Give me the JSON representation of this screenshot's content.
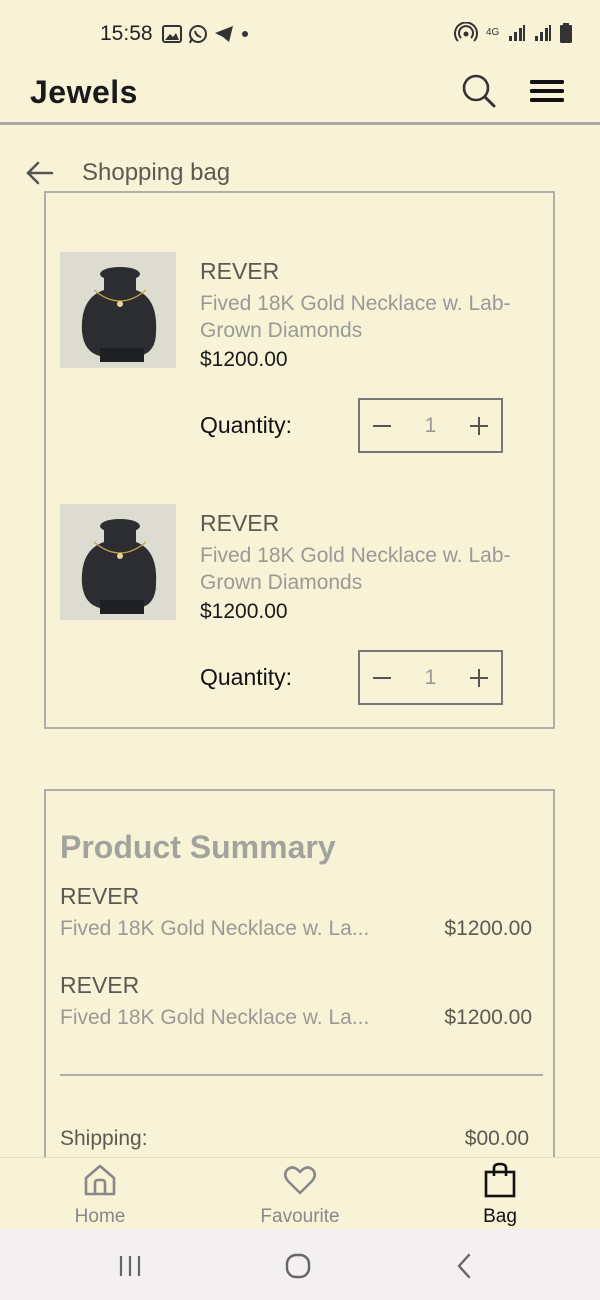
{
  "status_bar": {
    "time": "15:58",
    "left_icons": [
      "gallery-icon",
      "whatsapp-icon",
      "telegram-icon",
      "dot-icon"
    ],
    "right_icons": [
      "hotspot-icon",
      "network-4g-icon",
      "signal-icon",
      "signal-icon",
      "battery-icon"
    ],
    "network_label": "4G"
  },
  "app_bar": {
    "title": "Jewels",
    "icons": [
      "search-icon",
      "menu-icon"
    ]
  },
  "page": {
    "title": "Shopping bag",
    "back_icon": "arrow-left-icon"
  },
  "bag": {
    "items": [
      {
        "brand": "REVER",
        "name": "Fived 18K Gold Necklace w. Lab-Grown Diamonds",
        "price": "$1200.00",
        "quantity_label": "Quantity:",
        "quantity": "1"
      },
      {
        "brand": "REVER",
        "name": "Fived 18K Gold Necklace w. Lab-Grown Diamonds",
        "price": "$1200.00",
        "quantity_label": "Quantity:",
        "quantity": "1"
      }
    ]
  },
  "summary": {
    "title": "Product Summary",
    "items": [
      {
        "brand": "REVER",
        "name": "Fived 18K Gold Necklace w. La...",
        "price": "$1200.00"
      },
      {
        "brand": "REVER",
        "name": "Fived 18K Gold Necklace w. La...",
        "price": "$1200.00"
      }
    ],
    "shipping_label": "Shipping:",
    "shipping_value": "$00.00"
  },
  "bottom_nav": {
    "items": [
      {
        "label": "Home",
        "icon": "home-icon",
        "active": false
      },
      {
        "label": "Favourite",
        "icon": "heart-icon",
        "active": false
      },
      {
        "label": "Bag",
        "icon": "shopping-bag-icon",
        "active": true
      }
    ]
  },
  "system_nav": {
    "buttons": [
      "recent-apps-icon",
      "home-circle-icon",
      "back-chevron-icon"
    ]
  },
  "colors": {
    "background": "#f8f3d6",
    "border": "#aeaeaa",
    "muted_text": "#9a9a94",
    "dark_text": "#1a1a1a"
  }
}
